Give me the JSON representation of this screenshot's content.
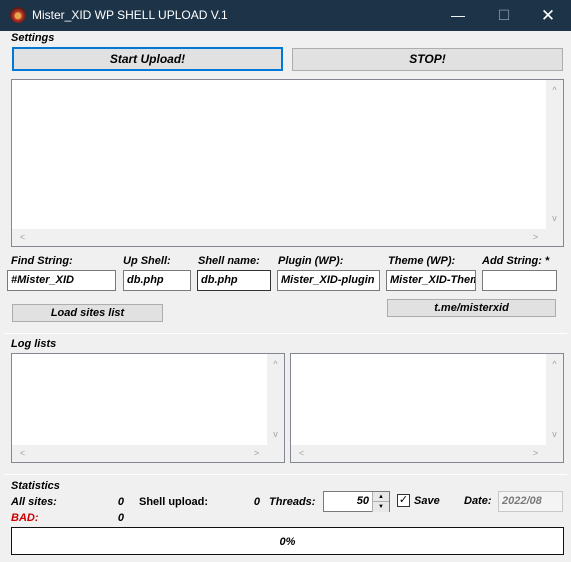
{
  "window": {
    "title": "Mister_XID WP SHELL UPLOAD V.1",
    "minimize_glyph": "—",
    "maximize_glyph": "☐",
    "close_glyph": "✕"
  },
  "settings": {
    "group_label": "Settings",
    "start_button": "Start Upload!",
    "stop_button": "STOP!"
  },
  "scroll_glyphs": {
    "up": "^",
    "down": "v",
    "left": "<",
    "right": ">",
    "spin_up": "▲",
    "spin_down": "▼"
  },
  "fields": {
    "find_string": {
      "label": "Find String:",
      "value": "#Mister_XID"
    },
    "up_shell": {
      "label": "Up Shell:",
      "value": "db.php"
    },
    "shell_name": {
      "label": "Shell name:",
      "value": "db.php"
    },
    "plugin": {
      "label": "Plugin (WP):",
      "value": "Mister_XID-plugin"
    },
    "theme": {
      "label": "Theme (WP):",
      "value": "Mister_XID-Theme"
    },
    "add_string": {
      "label": "Add String: *",
      "value": ""
    }
  },
  "load_sites_button": "Load sites list",
  "telegram_button": "t.me/misterxid",
  "log_lists": {
    "group_label": "Log lists"
  },
  "statistics": {
    "group_label": "Statistics",
    "all_sites_label": "All sites:",
    "all_sites_value": "0",
    "bad_label": "BAD:",
    "bad_value": "0",
    "shell_upload_label": "Shell upload:",
    "shell_upload_value": "0",
    "threads_label": "Threads:",
    "threads_value": "50",
    "save_label": "Save",
    "save_checked": true,
    "check_glyph": "✓",
    "date_label": "Date:",
    "date_value": "2022/08"
  },
  "progress": {
    "text": "0%",
    "percent": 0
  },
  "colors": {
    "titlebar": "#1d3348",
    "bad": "#cc0000",
    "focus": "#0078d7"
  }
}
